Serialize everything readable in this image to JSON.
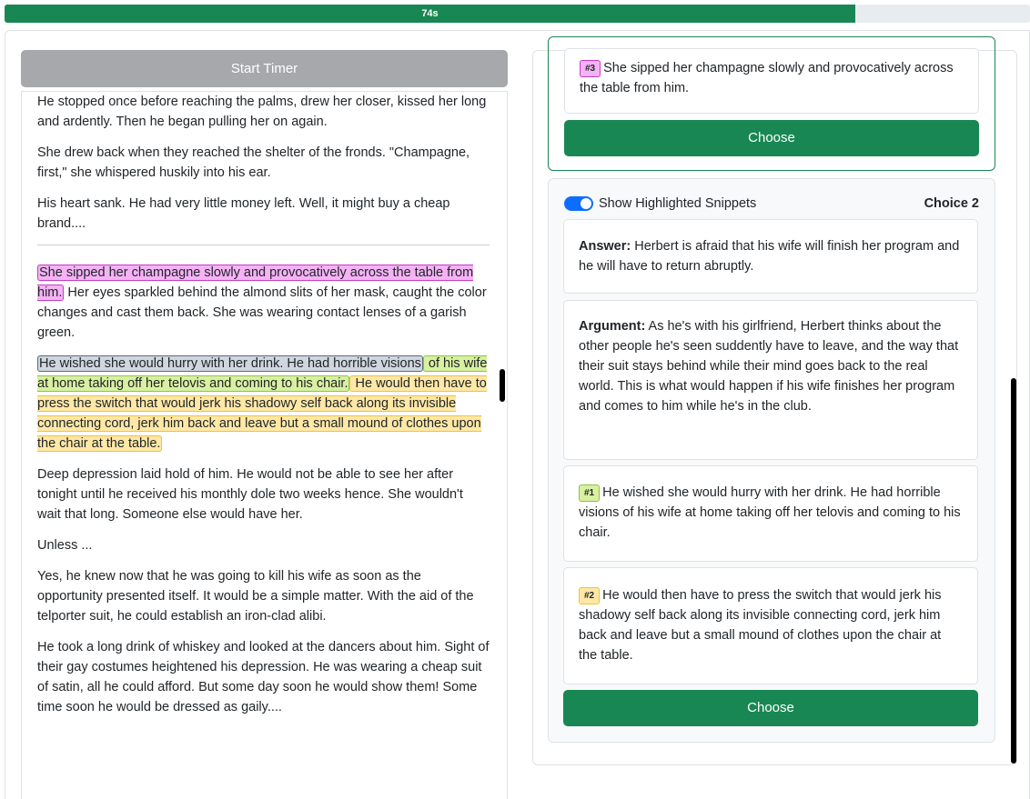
{
  "timer": {
    "label": "74s",
    "percent": 83
  },
  "left": {
    "start_timer_label": "Start Timer",
    "paragraphs_before": [
      "He stopped once before reaching the palms, drew her closer, kissed her long and ardently. Then he began pulling her on again.",
      "She drew back when they reached the shelter of the fronds. \"Champagne, first,\" she whispered huskily into his ear.",
      "His heart sank. He had very little money left. Well, it might buy a cheap brand...."
    ],
    "p4_hl_pink": "She sipped her champagne slowly and provocatively across the table from him.",
    "p4_rest": " Her eyes sparkled behind the almond slits of her mask, caught the color changes and cast them back. She was wearing contact lenses of a garish green.",
    "p5_hl_grey": "He wished she would hurry with her drink. He had horrible visions",
    "p5_hl_green": " of his wife at home taking off her telovis and coming to his chair.",
    "p5_hl_yellow": " He would then have to press the switch that would jerk his shadowy self back along its invisible connecting cord, jerk him back and leave but a small mound of clothes upon the chair at the table.",
    "paragraphs_after": [
      "Deep depression laid hold of him. He would not be able to see her after tonight until he received his monthly dole two weeks hence. She wouldn't wait that long. Someone else would have her.",
      "Unless ...",
      "Yes, he knew now that he was going to kill his wife as soon as the opportunity presented itself. It would be a simple matter. With the aid of the telporter suit, he could establish an iron-clad alibi.",
      "He took a long drink of whiskey and looked at the dancers about him. Sight of their gay costumes heightened his depression. He was wearing a cheap suit of satin, all he could afford. But some day soon he would show them! Some time soon he would be dressed as gaily...."
    ]
  },
  "choice1": {
    "snippet_badge": "#3",
    "snippet_text": "She sipped her champagne slowly and provocatively across the table from him.",
    "choose_label": "Choose"
  },
  "choice2": {
    "toggle_label": "Show Highlighted Snippets",
    "choice_label": "Choice 2",
    "answer_label": "Answer:",
    "answer_text": " Herbert is afraid that his wife will finish her program and he will have to return abruptly.",
    "argument_label": "Argument:",
    "argument_text": " As he's with his girlfriend, Herbert thinks about the other people he's seen suddently have to leave, and the way that their suit stays behind while their mind goes back to the real world. This is what would happen if his wife finishes her program and comes to him while he's in the club.",
    "snippet1_badge": "#1",
    "snippet1_text": "He wished she would hurry with her drink. He had horrible visions of his wife at home taking off her telovis and coming to his chair.",
    "snippet2_badge": "#2",
    "snippet2_text": "He would then have to press the switch that would jerk his shadowy self back along its invisible connecting cord, jerk him back and leave but a small mound of clothes upon the chair at the table.",
    "choose_label": "Choose"
  }
}
